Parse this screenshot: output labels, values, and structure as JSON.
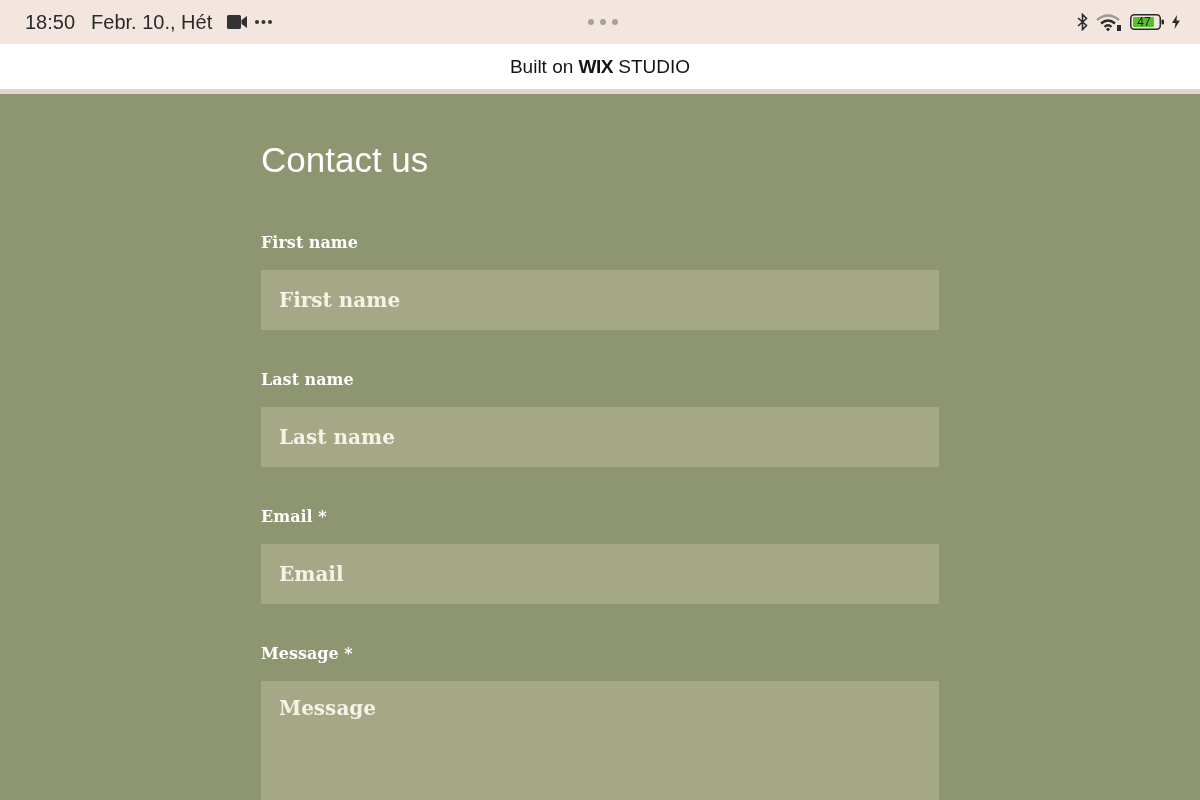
{
  "status_bar": {
    "time": "18:50",
    "date": "Febr. 10., Hét",
    "battery": "47"
  },
  "site_banner": {
    "text": "Built on **WIX** STUDIO"
  },
  "form": {
    "title": "Contact us",
    "fields": [
      {
        "kind": "input",
        "label": "First name",
        "placeholder": "First name"
      },
      {
        "kind": "input",
        "label": "Last name",
        "placeholder": "Last name"
      },
      {
        "kind": "input",
        "label": "Email *",
        "placeholder": "Email"
      },
      {
        "kind": "textarea",
        "label": "Message *",
        "placeholder": "Message"
      }
    ]
  }
}
